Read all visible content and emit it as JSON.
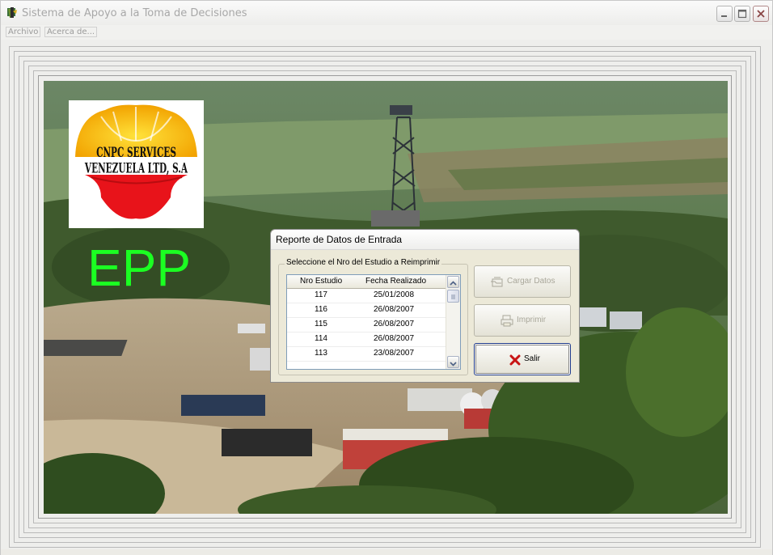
{
  "window": {
    "title": "Sistema de Apoyo a la Toma de Decisiones",
    "controls": [
      "minimize-icon",
      "maximize-icon",
      "close-icon"
    ]
  },
  "menu": {
    "items": [
      {
        "label": "Archivo"
      },
      {
        "label": "Acerca de..."
      }
    ]
  },
  "brand": {
    "logo_text": "CNPC SERVICES VENEZUELA LTD, S.A",
    "epp_label": "EPP",
    "epp_color": "#1bff22"
  },
  "dialog": {
    "title": "Reporte de Datos de Entrada",
    "group_label": "Seleccione el Nro del Estudio a Reimprimir",
    "columns": [
      "Nro Estudio",
      "Fecha Realizado"
    ],
    "rows": [
      {
        "nro": "117",
        "fecha": "25/01/2008"
      },
      {
        "nro": "116",
        "fecha": "26/08/2007"
      },
      {
        "nro": "115",
        "fecha": "26/08/2007"
      },
      {
        "nro": "114",
        "fecha": "26/08/2007"
      },
      {
        "nro": "113",
        "fecha": "23/08/2007"
      }
    ],
    "buttons": {
      "cargar": "Cargar Datos",
      "imprimir": "Imprimir",
      "salir": "Salir"
    }
  }
}
